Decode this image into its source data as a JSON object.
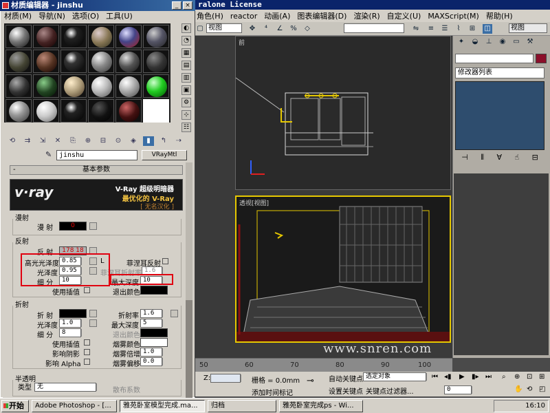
{
  "app": {
    "title": "ralone License",
    "menu": [
      "角色(H)",
      "reactor",
      "动画(A)",
      "图表编辑器(D)",
      "渲染(R)",
      "自定义(U)",
      "MAXScript(M)",
      "帮助(H)"
    ],
    "view_left": "视图",
    "view_right": "视图"
  },
  "viewports": {
    "front_label": "前",
    "persp_label": "透视[视图]",
    "watermark": "www.snren.com"
  },
  "timeline": {
    "ticks": [
      "50",
      "60",
      "70",
      "80",
      "90",
      "100"
    ],
    "z_label": "Z:",
    "grid_label": "栅格 = 0.0mm",
    "add_time_tag": "添加时间标记",
    "auto_key": "自动关键点",
    "set_key": "设置关键点",
    "selected_object": "选定对象",
    "key_filters": "关键点过滤器...",
    "frame": "0"
  },
  "command_panel": {
    "modifier_list": "修改器列表",
    "name_color": "#8b0f2a"
  },
  "material_editor": {
    "title": "材质编辑器 - jinshu",
    "menu": [
      "材质(M)",
      "导航(N)",
      "选项(O)",
      "工具(U)"
    ],
    "material_name": "jinshu",
    "material_type": "VRayMtl",
    "rollout_title": "基本参数",
    "vray": {
      "logo": "v·ray",
      "line1": "V-Ray 超级明暗器",
      "line2": "最优化的 V-Ray",
      "line3": "[ 无名汉化 ]"
    },
    "diffuse": {
      "group": "漫射",
      "label": "漫 射",
      "value": "0"
    },
    "reflection": {
      "group": "反射",
      "reflect_label": "反 射",
      "reflect_value": "178 18",
      "hilight_gloss_label": "高光光泽度",
      "hilight_gloss": "0.85",
      "lock_label": "L",
      "fresnel_label": "菲涅耳反射",
      "fresnel_ior_label": "菲涅耳折射率",
      "fresnel_ior": "1.6",
      "gloss_label": "光泽度",
      "gloss": "0.95",
      "subdivs_label": "细 分",
      "subdivs": "10",
      "max_depth_label": "最大深度",
      "max_depth": "10",
      "use_interp_label": "使用插值",
      "exit_color_label": "退出颜色"
    },
    "refraction": {
      "group": "折射",
      "refract_label": "折 射",
      "ior_label": "折射率",
      "ior": "1.6",
      "gloss_label": "光泽度",
      "gloss": "1.0",
      "max_depth_label": "最大深度",
      "max_depth": "5",
      "subdivs_label": "细 分",
      "subdivs": "8",
      "exit_color_label": "退出颜色",
      "use_interp_label": "使用插值",
      "fog_color_label": "烟雾颜色",
      "affect_shadows_label": "影响阴影",
      "fog_mult_label": "烟雾倍增",
      "fog_mult": "1.0",
      "affect_alpha_label": "影响 Alpha",
      "fog_bias_label": "烟雾偏移",
      "fog_bias": "0.0"
    },
    "translucency": {
      "group": "半透明",
      "type_label": "类型",
      "type_value": "无",
      "scatter_label": "散布系数"
    }
  },
  "taskbar": {
    "start": "开始",
    "tasks": [
      "Adobe Photoshop - [...",
      "雅苑卧室模型完成.ma...",
      "归档",
      "雅苑卧室完成ps - Wi..."
    ],
    "clock": "16:10"
  }
}
